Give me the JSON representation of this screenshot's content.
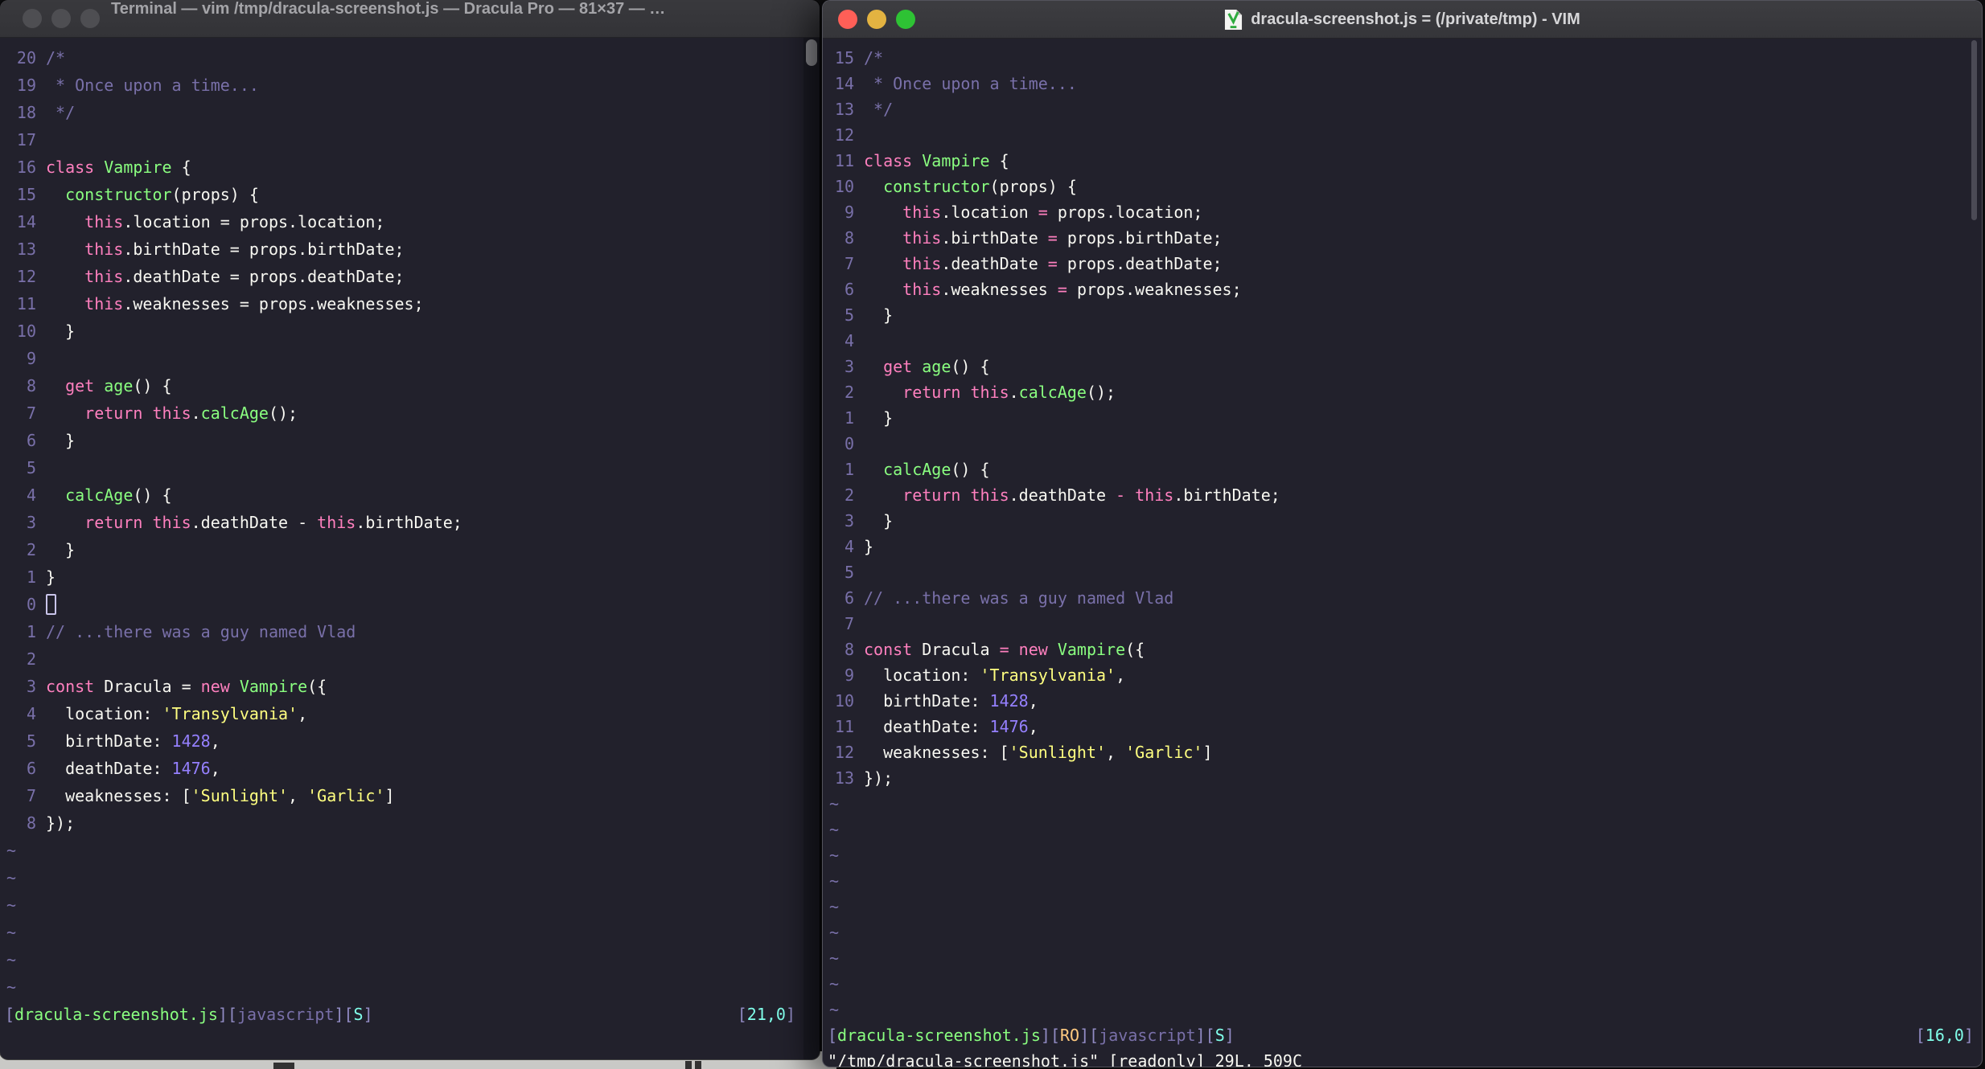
{
  "left_window": {
    "title": "Terminal — vim /tmp/dracula-screenshot.js — Dracula Pro — 81×37 — …",
    "active": false,
    "tilde_count": 6,
    "lines": [
      {
        "n": "20",
        "s": [
          [
            "cm",
            "/*"
          ]
        ]
      },
      {
        "n": "19",
        "s": [
          [
            "cm",
            " * Once upon a time..."
          ]
        ]
      },
      {
        "n": "18",
        "s": [
          [
            "cm",
            " */"
          ]
        ]
      },
      {
        "n": "17",
        "s": []
      },
      {
        "n": "16",
        "s": [
          [
            "pk",
            "class "
          ],
          [
            "gr",
            "Vampire"
          ],
          [
            "fg",
            " {"
          ]
        ]
      },
      {
        "n": "15",
        "s": [
          [
            "fg",
            "  "
          ],
          [
            "gr",
            "constructor"
          ],
          [
            "fg",
            "(props) {"
          ]
        ]
      },
      {
        "n": "14",
        "s": [
          [
            "fg",
            "    "
          ],
          [
            "pk",
            "this"
          ],
          [
            "fg",
            ".location = props.location;"
          ]
        ]
      },
      {
        "n": "13",
        "s": [
          [
            "fg",
            "    "
          ],
          [
            "pk",
            "this"
          ],
          [
            "fg",
            ".birthDate = props.birthDate;"
          ]
        ]
      },
      {
        "n": "12",
        "s": [
          [
            "fg",
            "    "
          ],
          [
            "pk",
            "this"
          ],
          [
            "fg",
            ".deathDate = props.deathDate;"
          ]
        ]
      },
      {
        "n": "11",
        "s": [
          [
            "fg",
            "    "
          ],
          [
            "pk",
            "this"
          ],
          [
            "fg",
            ".weaknesses = props.weaknesses;"
          ]
        ]
      },
      {
        "n": "10",
        "s": [
          [
            "fg",
            "  }"
          ]
        ]
      },
      {
        "n": "9",
        "s": []
      },
      {
        "n": "8",
        "s": [
          [
            "fg",
            "  "
          ],
          [
            "pk",
            "get "
          ],
          [
            "gr",
            "age"
          ],
          [
            "fg",
            "() {"
          ]
        ]
      },
      {
        "n": "7",
        "s": [
          [
            "fg",
            "    "
          ],
          [
            "pk",
            "return this"
          ],
          [
            "fg",
            "."
          ],
          [
            "gr",
            "calcAge"
          ],
          [
            "fg",
            "();"
          ]
        ]
      },
      {
        "n": "6",
        "s": [
          [
            "fg",
            "  }"
          ]
        ]
      },
      {
        "n": "5",
        "s": []
      },
      {
        "n": "4",
        "s": [
          [
            "fg",
            "  "
          ],
          [
            "gr",
            "calcAge"
          ],
          [
            "fg",
            "() {"
          ]
        ]
      },
      {
        "n": "3",
        "s": [
          [
            "fg",
            "    "
          ],
          [
            "pk",
            "return this"
          ],
          [
            "fg",
            ".deathDate - "
          ],
          [
            "pk",
            "this"
          ],
          [
            "fg",
            ".birthDate;"
          ]
        ]
      },
      {
        "n": "2",
        "s": [
          [
            "fg",
            "  }"
          ]
        ]
      },
      {
        "n": "1",
        "s": [
          [
            "fg",
            "}"
          ]
        ]
      },
      {
        "n": "0",
        "s": [],
        "cursor": true
      },
      {
        "n": "1",
        "s": [
          [
            "cm",
            "// ...there was a guy named Vlad"
          ]
        ]
      },
      {
        "n": "2",
        "s": []
      },
      {
        "n": "3",
        "s": [
          [
            "pk",
            "const "
          ],
          [
            "fg",
            "Dracula = "
          ],
          [
            "pk",
            "new "
          ],
          [
            "gr",
            "Vampire"
          ],
          [
            "fg",
            "({"
          ]
        ]
      },
      {
        "n": "4",
        "s": [
          [
            "fg",
            "  location: "
          ],
          [
            "yl",
            "'Transylvania'"
          ],
          [
            "fg",
            ","
          ]
        ]
      },
      {
        "n": "5",
        "s": [
          [
            "fg",
            "  birthDate: "
          ],
          [
            "pu",
            "1428"
          ],
          [
            "fg",
            ","
          ]
        ]
      },
      {
        "n": "6",
        "s": [
          [
            "fg",
            "  deathDate: "
          ],
          [
            "pu",
            "1476"
          ],
          [
            "fg",
            ","
          ]
        ]
      },
      {
        "n": "7",
        "s": [
          [
            "fg",
            "  weaknesses: ["
          ],
          [
            "yl",
            "'Sunlight'"
          ],
          [
            "fg",
            ", "
          ],
          [
            "yl",
            "'Garlic'"
          ],
          [
            "fg",
            "]"
          ]
        ]
      },
      {
        "n": "8",
        "s": [
          [
            "fg",
            "});"
          ]
        ]
      }
    ],
    "status_left": [
      [
        "br",
        "["
      ],
      [
        "gr",
        "dracula-screenshot.js"
      ],
      [
        "br",
        "]["
      ],
      [
        "mu",
        "javascript"
      ],
      [
        "br",
        "]["
      ],
      [
        "cy",
        "S"
      ],
      [
        "br",
        "]"
      ]
    ],
    "status_right": [
      [
        "br",
        "["
      ],
      [
        "cy",
        "21,0"
      ],
      [
        "br",
        "]"
      ]
    ]
  },
  "right_window": {
    "title": "dracula-screenshot.js = (/private/tmp) - VIM",
    "active": true,
    "tilde_count": 9,
    "lines": [
      {
        "n": "15",
        "s": [
          [
            "cm",
            "/*"
          ]
        ]
      },
      {
        "n": "14",
        "s": [
          [
            "cm",
            " * Once upon a time..."
          ]
        ]
      },
      {
        "n": "13",
        "s": [
          [
            "cm",
            " */"
          ]
        ]
      },
      {
        "n": "12",
        "s": []
      },
      {
        "n": "11",
        "s": [
          [
            "pk",
            "class "
          ],
          [
            "gr",
            "Vampire"
          ],
          [
            "fg",
            " {"
          ]
        ]
      },
      {
        "n": "10",
        "s": [
          [
            "fg",
            "  "
          ],
          [
            "gr",
            "constructor"
          ],
          [
            "fg",
            "(props) {"
          ]
        ]
      },
      {
        "n": "9",
        "s": [
          [
            "fg",
            "    "
          ],
          [
            "pk",
            "this"
          ],
          [
            "fg",
            ".location "
          ],
          [
            "pk",
            "= "
          ],
          [
            "fg",
            "props.location;"
          ]
        ]
      },
      {
        "n": "8",
        "s": [
          [
            "fg",
            "    "
          ],
          [
            "pk",
            "this"
          ],
          [
            "fg",
            ".birthDate "
          ],
          [
            "pk",
            "= "
          ],
          [
            "fg",
            "props.birthDate;"
          ]
        ]
      },
      {
        "n": "7",
        "s": [
          [
            "fg",
            "    "
          ],
          [
            "pk",
            "this"
          ],
          [
            "fg",
            ".deathDate "
          ],
          [
            "pk",
            "= "
          ],
          [
            "fg",
            "props.deathDate;"
          ]
        ]
      },
      {
        "n": "6",
        "s": [
          [
            "fg",
            "    "
          ],
          [
            "pk",
            "this"
          ],
          [
            "fg",
            ".weaknesses "
          ],
          [
            "pk",
            "= "
          ],
          [
            "fg",
            "props.weaknesses;"
          ]
        ]
      },
      {
        "n": "5",
        "s": [
          [
            "fg",
            "  }"
          ]
        ]
      },
      {
        "n": "4",
        "s": []
      },
      {
        "n": "3",
        "s": [
          [
            "fg",
            "  "
          ],
          [
            "pk",
            "get "
          ],
          [
            "gr",
            "age"
          ],
          [
            "fg",
            "() {"
          ]
        ]
      },
      {
        "n": "2",
        "s": [
          [
            "fg",
            "    "
          ],
          [
            "pk",
            "return this"
          ],
          [
            "fg",
            "."
          ],
          [
            "gr",
            "calcAge"
          ],
          [
            "fg",
            "();"
          ]
        ]
      },
      {
        "n": "1",
        "s": [
          [
            "fg",
            "  }"
          ]
        ]
      },
      {
        "n": "0",
        "s": []
      },
      {
        "n": "1",
        "s": [
          [
            "fg",
            "  "
          ],
          [
            "gr",
            "calcAge"
          ],
          [
            "fg",
            "() {"
          ]
        ]
      },
      {
        "n": "2",
        "s": [
          [
            "fg",
            "    "
          ],
          [
            "pk",
            "return this"
          ],
          [
            "fg",
            ".deathDate "
          ],
          [
            "pk",
            "- this"
          ],
          [
            "fg",
            ".birthDate;"
          ]
        ]
      },
      {
        "n": "3",
        "s": [
          [
            "fg",
            "  }"
          ]
        ]
      },
      {
        "n": "4",
        "s": [
          [
            "fg",
            "}"
          ]
        ]
      },
      {
        "n": "5",
        "s": []
      },
      {
        "n": "6",
        "s": [
          [
            "cm",
            "// ...there was a guy named Vlad"
          ]
        ]
      },
      {
        "n": "7",
        "s": []
      },
      {
        "n": "8",
        "s": [
          [
            "pk",
            "const "
          ],
          [
            "fg",
            "Dracula "
          ],
          [
            "pk",
            "= new "
          ],
          [
            "gr",
            "Vampire"
          ],
          [
            "fg",
            "({"
          ]
        ]
      },
      {
        "n": "9",
        "s": [
          [
            "fg",
            "  location: "
          ],
          [
            "yl",
            "'Transylvania'"
          ],
          [
            "fg",
            ","
          ]
        ]
      },
      {
        "n": "10",
        "s": [
          [
            "fg",
            "  birthDate: "
          ],
          [
            "pu",
            "1428"
          ],
          [
            "fg",
            ","
          ]
        ]
      },
      {
        "n": "11",
        "s": [
          [
            "fg",
            "  deathDate: "
          ],
          [
            "pu",
            "1476"
          ],
          [
            "fg",
            ","
          ]
        ]
      },
      {
        "n": "12",
        "s": [
          [
            "fg",
            "  weaknesses: ["
          ],
          [
            "yl",
            "'Sunlight'"
          ],
          [
            "fg",
            ", "
          ],
          [
            "yl",
            "'Garlic'"
          ],
          [
            "fg",
            "]"
          ]
        ]
      },
      {
        "n": "13",
        "s": [
          [
            "fg",
            "});"
          ]
        ]
      }
    ],
    "status_left": [
      [
        "br",
        "["
      ],
      [
        "gr",
        "dracula-screenshot.js"
      ],
      [
        "br",
        "]["
      ],
      [
        "or",
        "RO"
      ],
      [
        "br",
        "]["
      ],
      [
        "mu",
        "javascript"
      ],
      [
        "br",
        "]["
      ],
      [
        "cy",
        "S"
      ],
      [
        "br",
        "]"
      ]
    ],
    "status_right": [
      [
        "br",
        "["
      ],
      [
        "cy",
        "16,0"
      ],
      [
        "br",
        "]"
      ]
    ],
    "message_line": "\"/tmp/dracula-screenshot.js\" [readonly] 29L, 509C"
  },
  "theme": {
    "background": "#22212C",
    "foreground": "#F8F8F2",
    "comment": "#7970A9",
    "pink": "#FF80BF",
    "green": "#8AFF80",
    "yellow": "#FFFF80",
    "purple": "#9580FF",
    "cyan": "#80FFEA",
    "orange": "#FFCA80"
  }
}
